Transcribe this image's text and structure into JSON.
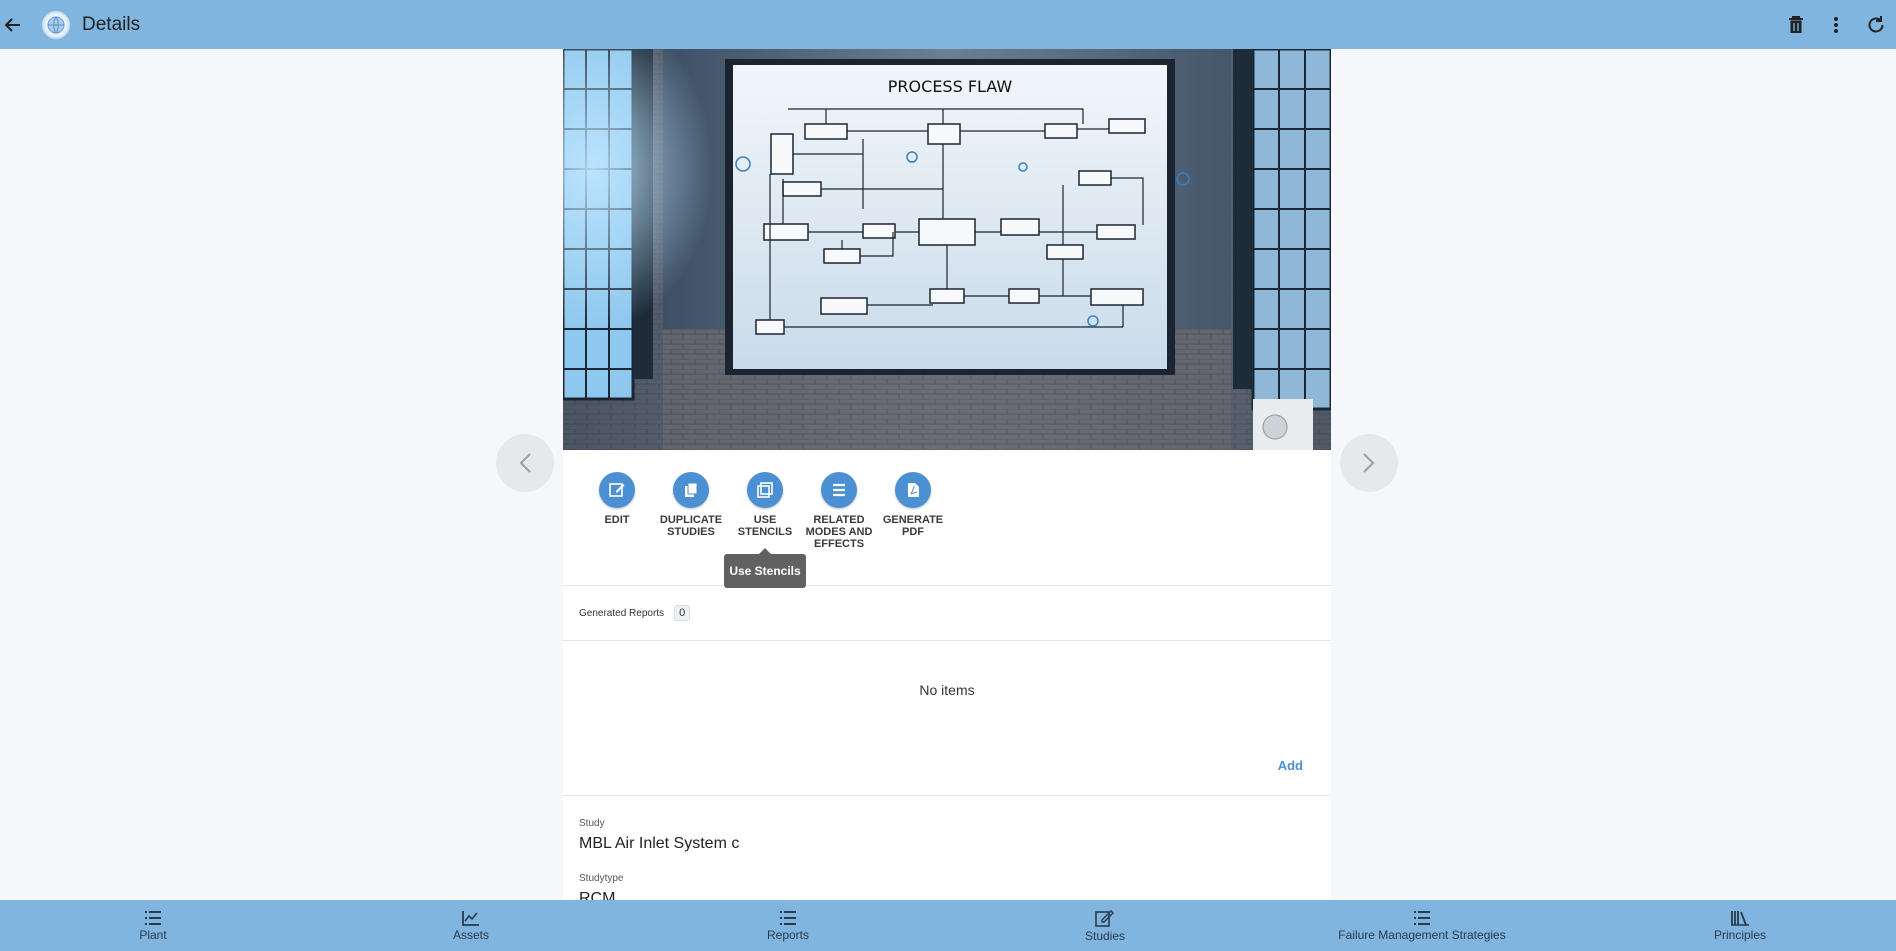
{
  "header": {
    "title": "Details",
    "back_icon": "arrow-left-icon",
    "logo_icon": "globe-icon",
    "actions": [
      "trash-icon",
      "more-vertical-icon",
      "refresh-icon"
    ]
  },
  "hero": {
    "board_title": "PROCESS FLAW",
    "prev_icon": "chevron-left-icon",
    "next_icon": "chevron-right-icon"
  },
  "actions": [
    {
      "line1": "EDIT",
      "line2": "",
      "line3": "",
      "icon": "edit-icon"
    },
    {
      "line1": "DUPLICATE",
      "line2": "STUDIES",
      "line3": "",
      "icon": "copy-icon"
    },
    {
      "line1": "USE",
      "line2": "STENCILS",
      "line3": "",
      "icon": "stencil-icon"
    },
    {
      "line1": "RELATED",
      "line2": "MODES AND",
      "line3": "EFFECTS",
      "icon": "list-icon"
    },
    {
      "line1": "GENERATE",
      "line2": "PDF",
      "line3": "",
      "icon": "pdf-icon"
    }
  ],
  "tooltip": "Use Stencils",
  "reports": {
    "label": "Generated Reports",
    "count": "0",
    "empty_text": "No items",
    "add_label": "Add"
  },
  "fields": {
    "study_label": "Study",
    "study_value": "MBL Air Inlet System c",
    "studytype_label": "Studytype",
    "studytype_value": "RCM"
  },
  "bottom_nav": [
    {
      "label": "Plant",
      "icon": "list-icon"
    },
    {
      "label": "Assets",
      "icon": "chart-icon"
    },
    {
      "label": "Reports",
      "icon": "list-icon"
    },
    {
      "label": "Studies",
      "icon": "edit-doc-icon"
    },
    {
      "label": "Failure Management Strategies",
      "icon": "list-icon"
    },
    {
      "label": "Principles",
      "icon": "books-icon"
    }
  ],
  "colors": {
    "bar": "#7fb5de",
    "accent": "#4a90d2"
  }
}
